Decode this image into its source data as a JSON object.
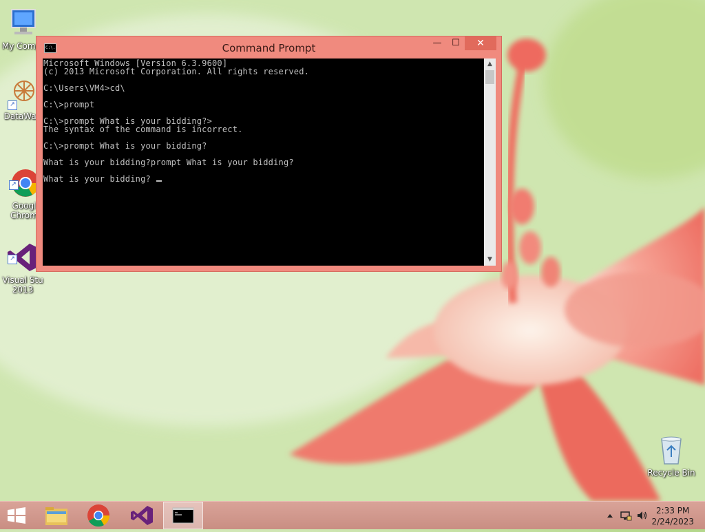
{
  "colors": {
    "window_frame": "#f08a7e",
    "console_bg": "#000000",
    "console_fg": "#c0c0c0",
    "taskbar": "#d9a398"
  },
  "desktop": {
    "icons": [
      {
        "label": "My Comp",
        "icon": "computer-icon"
      },
      {
        "label": "DataWag",
        "icon": "datawag-icon"
      },
      {
        "label": "Googl\nChrom",
        "icon": "chrome-icon"
      },
      {
        "label": "Visual Stu\n2013",
        "icon": "visual-studio-icon"
      },
      {
        "label": "Recycle Bin",
        "icon": "recycle-bin-icon"
      }
    ]
  },
  "cmd": {
    "title": "Command Prompt",
    "app_icon_text": "C:\\.",
    "minimize": "—",
    "maximize": "☐",
    "close": "✕",
    "lines": [
      "Microsoft Windows [Version 6.3.9600]",
      "(c) 2013 Microsoft Corporation. All rights reserved.",
      "",
      "C:\\Users\\VM4>cd\\",
      "",
      "C:\\>prompt",
      "",
      "C:\\>prompt What is your bidding?>",
      "The syntax of the command is incorrect.",
      "",
      "C:\\>prompt What is your bidding?",
      "",
      "What is your bidding?prompt What is your bidding?",
      "",
      "What is your bidding? "
    ]
  },
  "taskbar": {
    "items": [
      {
        "name": "start-button",
        "icon": "windows-logo-icon"
      },
      {
        "name": "file-explorer",
        "icon": "folder-icon"
      },
      {
        "name": "google-chrome",
        "icon": "chrome-icon"
      },
      {
        "name": "visual-studio",
        "icon": "visual-studio-icon"
      },
      {
        "name": "command-prompt",
        "icon": "cmd-icon",
        "active": true
      }
    ],
    "tray": {
      "icons": [
        "show-hidden-icons-icon",
        "network-icon",
        "volume-icon"
      ],
      "time": "2:33 PM",
      "date": "2/24/2023"
    }
  }
}
